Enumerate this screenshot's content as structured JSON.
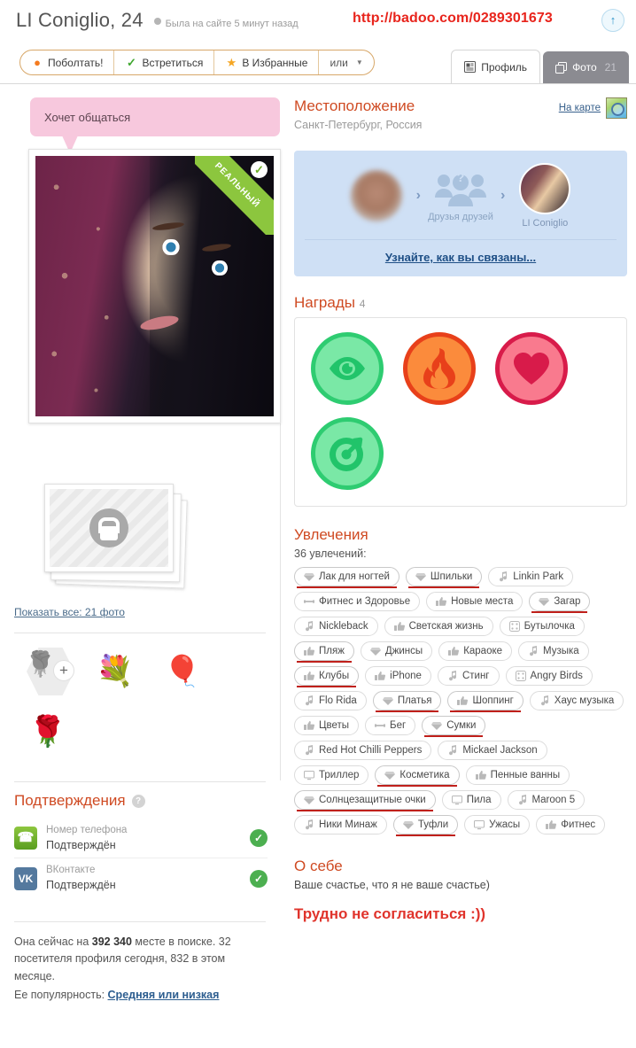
{
  "header": {
    "name": "LI Coniglio, 24",
    "last_seen": "Была на сайте 5 минут назад",
    "profile_url": "http://badoo.com/0289301673",
    "up_icon": "arrow-up-icon",
    "actions": [
      {
        "label": "Поболтать!",
        "icon": "chat-bubble-icon"
      },
      {
        "label": "Встретиться",
        "icon": "check-icon"
      },
      {
        "label": "В Избранные",
        "icon": "star-icon"
      }
    ],
    "or_label": "или",
    "tabs": [
      {
        "label": "Профиль",
        "icon": "profile-icon",
        "active": true,
        "count": ""
      },
      {
        "label": "Фото",
        "icon": "photos-icon",
        "active": false,
        "count": "21"
      }
    ]
  },
  "left": {
    "bubble_text": "Хочет общаться",
    "photo_ribbon": "РЕАЛЬНЫЙ",
    "show_all_link": "Показать все: 21 фото",
    "gifts": [
      {
        "name": "add-gift",
        "glyph": "🌹"
      },
      {
        "name": "bouquet-gift",
        "glyph": "💐"
      },
      {
        "name": "balloons-gift",
        "glyph": "🎈"
      },
      {
        "name": "rose-gift",
        "glyph": "🌹"
      }
    ],
    "verifications": {
      "title": "Подтверждения",
      "help_icon": "question-mark-icon",
      "rows": [
        {
          "icon": "phone-icon",
          "label": "Номер телефона",
          "status": "Подтверждён",
          "check": "check-icon"
        },
        {
          "icon": "vk-icon",
          "glyph": "VK",
          "label": "ВКонтакте",
          "status": "Подтверждён",
          "check": "check-icon"
        }
      ]
    },
    "stats_prefix": "Она сейчас на ",
    "stats_rank": "392 340",
    "stats_suffix": " месте в поиске. 32 посетителя профиля сегодня, 832 в этом месяце.",
    "popularity_label": "Ее популярность: ",
    "popularity_value": "Средняя или низкая"
  },
  "right": {
    "location": {
      "title": "Местоположение",
      "city": "Санкт-Петербург, Россия",
      "map_link": "На карте",
      "map_icon": "map-magnifier-icon"
    },
    "connection": {
      "middle_label": "Друзья друзей",
      "target_label": "LI Coniglio",
      "link": "Узнайте, как вы связаны..."
    },
    "awards": {
      "title": "Награды",
      "count": "4",
      "items": [
        {
          "name": "eye-award",
          "icon": "eye-icon"
        },
        {
          "name": "fire-award",
          "icon": "fire-icon"
        },
        {
          "name": "heart-award",
          "icon": "heart-icon"
        },
        {
          "name": "target-award",
          "icon": "target-icon"
        }
      ]
    },
    "interests": {
      "title": "Увлечения",
      "count_label": "36 увлечений:",
      "tags": [
        {
          "label": "Лак для ногтей",
          "icon": "diamond-icon",
          "highlight": true
        },
        {
          "label": "Шпильки",
          "icon": "diamond-icon",
          "highlight": true
        },
        {
          "label": "Linkin Park",
          "icon": "music-icon",
          "highlight": false
        },
        {
          "label": "Фитнес и Здоровье",
          "icon": "dumbbell-icon",
          "highlight": false
        },
        {
          "label": "Новые места",
          "icon": "thumb-up-icon",
          "highlight": false
        },
        {
          "label": "Загар",
          "icon": "diamond-icon",
          "highlight": true
        },
        {
          "label": "Nickleback",
          "icon": "music-icon",
          "highlight": false
        },
        {
          "label": "Светская жизнь",
          "icon": "thumb-up-icon",
          "highlight": false
        },
        {
          "label": "Бутылочка",
          "icon": "dice-icon",
          "highlight": false
        },
        {
          "label": "Пляж",
          "icon": "thumb-up-icon",
          "highlight": true
        },
        {
          "label": "Джинсы",
          "icon": "diamond-icon",
          "highlight": false
        },
        {
          "label": "Караоке",
          "icon": "thumb-up-icon",
          "highlight": false
        },
        {
          "label": "Музыка",
          "icon": "music-icon",
          "highlight": false
        },
        {
          "label": "Клубы",
          "icon": "thumb-up-icon",
          "highlight": true
        },
        {
          "label": "iPhone",
          "icon": "thumb-up-icon",
          "highlight": false
        },
        {
          "label": "Стинг",
          "icon": "music-icon",
          "highlight": false
        },
        {
          "label": "Angry Birds",
          "icon": "dice-icon",
          "highlight": false
        },
        {
          "label": "Flo Rida",
          "icon": "music-icon",
          "highlight": false
        },
        {
          "label": "Платья",
          "icon": "diamond-icon",
          "highlight": true
        },
        {
          "label": "Шоппинг",
          "icon": "thumb-up-icon",
          "highlight": true
        },
        {
          "label": "Хаус музыка",
          "icon": "music-icon",
          "highlight": false
        },
        {
          "label": "Цветы",
          "icon": "thumb-up-icon",
          "highlight": false
        },
        {
          "label": "Бег",
          "icon": "dumbbell-icon",
          "highlight": false
        },
        {
          "label": "Сумки",
          "icon": "diamond-icon",
          "highlight": true
        },
        {
          "label": "Red Hot Chilli Peppers",
          "icon": "music-icon",
          "highlight": false
        },
        {
          "label": "Mickael Jackson",
          "icon": "music-icon",
          "highlight": false
        },
        {
          "label": "Триллер",
          "icon": "tv-icon",
          "highlight": false
        },
        {
          "label": "Косметика",
          "icon": "diamond-icon",
          "highlight": true
        },
        {
          "label": "Пенные ванны",
          "icon": "thumb-up-icon",
          "highlight": false
        },
        {
          "label": "Солнцезащитные очки",
          "icon": "diamond-icon",
          "highlight": true
        },
        {
          "label": "Пила",
          "icon": "tv-icon",
          "highlight": false
        },
        {
          "label": "Maroon 5",
          "icon": "music-icon",
          "highlight": false
        },
        {
          "label": "Ники Минаж",
          "icon": "music-icon",
          "highlight": false
        },
        {
          "label": "Туфли",
          "icon": "diamond-icon",
          "highlight": true
        },
        {
          "label": "Ужасы",
          "icon": "tv-icon",
          "highlight": false
        },
        {
          "label": "Фитнес",
          "icon": "thumb-up-icon",
          "highlight": false
        }
      ]
    },
    "about": {
      "title": "О себе",
      "text": "Ваше счастье, что я не ваше счастье)",
      "note": "Трудно не согласиться :))"
    }
  },
  "colors": {
    "accent": "#cf4a22",
    "url_red": "#e8241c",
    "link_blue": "#2c5d8f",
    "bubble_pink": "#f7c8dd",
    "connect_blue": "#cfe0f5",
    "highlight_underline": "#c0201b"
  }
}
